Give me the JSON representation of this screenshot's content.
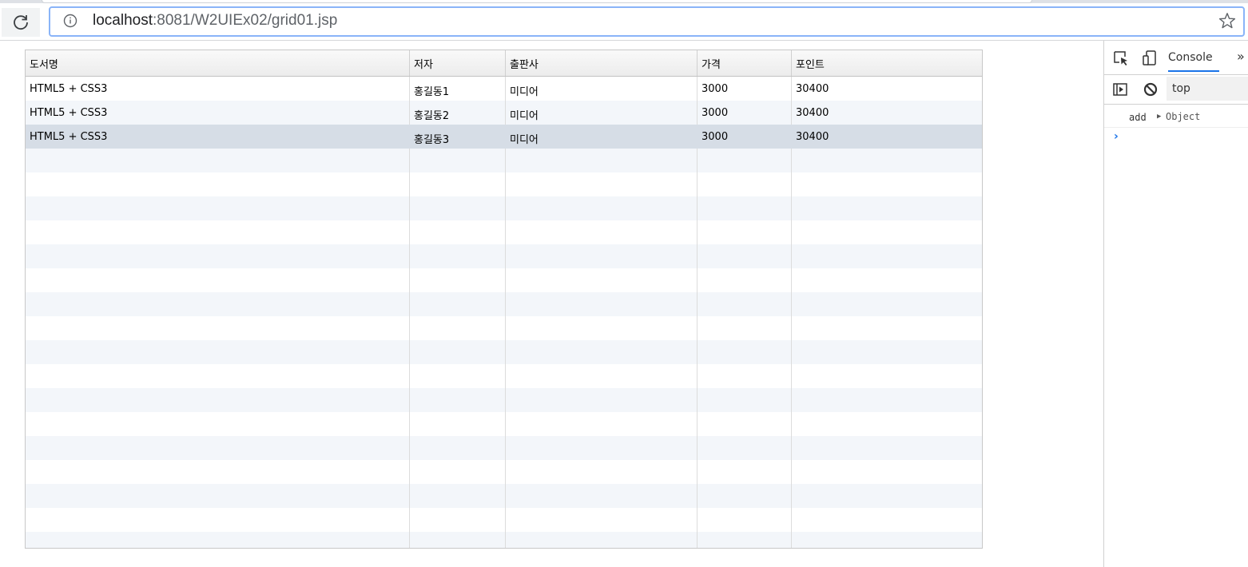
{
  "browser": {
    "url_host": "localhost",
    "url_rest": ":8081/W2UIEx02/grid01.jsp"
  },
  "grid": {
    "columns": [
      "도서명",
      "저자",
      "출판사",
      "가격",
      "포인트"
    ],
    "rows": [
      [
        "HTML5 + CSS3",
        "홍길동1",
        "미디어",
        "3000",
        "30400"
      ],
      [
        "HTML5 + CSS3",
        "홍길동2",
        "미디어",
        "3000",
        "30400"
      ],
      [
        "HTML5 + CSS3",
        "홍길동3",
        "미디어",
        "3000",
        "30400"
      ]
    ],
    "selected_row": 3
  },
  "devtools": {
    "console_tab": "Console",
    "more": "»",
    "context": "top",
    "log_message": "add",
    "log_object": "Object",
    "prompt": "›"
  },
  "colors": {
    "accent": "#1a73e8",
    "row_alt": "#f3f6fa",
    "row_selected": "#d6dde6"
  }
}
